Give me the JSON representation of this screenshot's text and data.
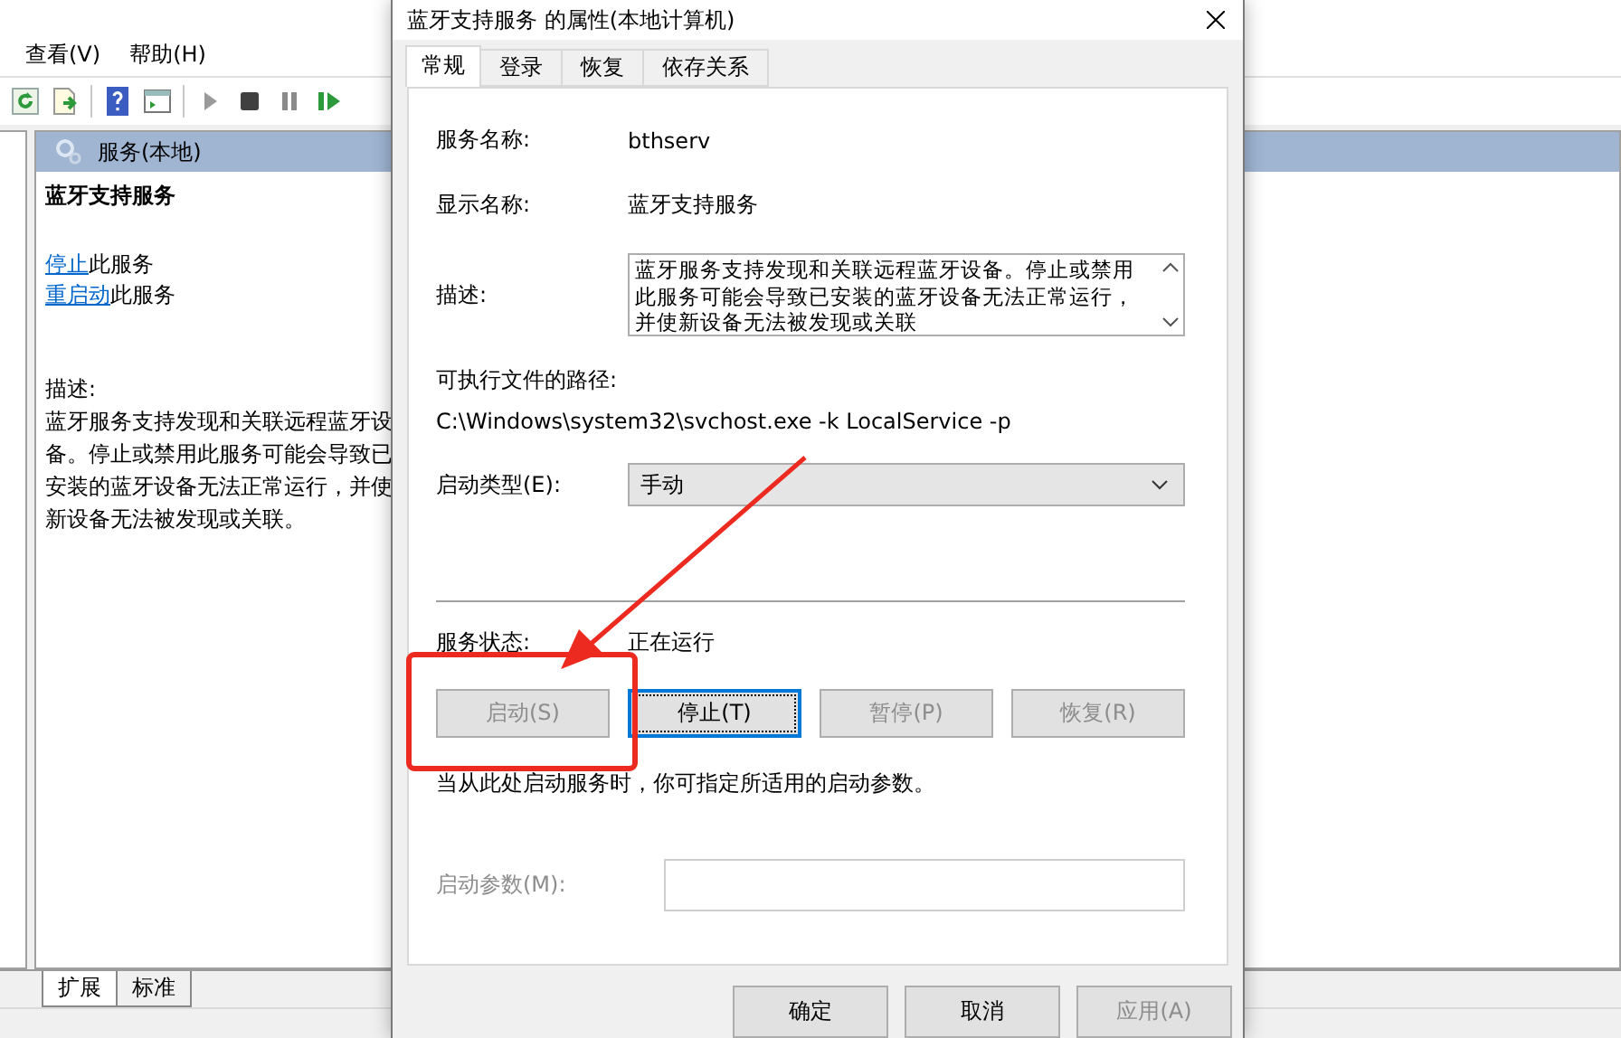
{
  "menu": [
    {
      "label": "查看(V)"
    },
    {
      "label": "帮助(H)"
    }
  ],
  "pane": {
    "header": "服务(本地)",
    "service_title": "蓝牙支持服务",
    "actions": [
      {
        "link": "停止",
        "text": "此服务"
      },
      {
        "link": "重启动",
        "text": "此服务"
      }
    ],
    "description_label": "描述:",
    "description": "蓝牙服务支持发现和关联远程蓝牙设备。停止或禁用此服务可能会导致已安装的蓝牙设备无法正常运行，并使新设备无法被发现或关联。"
  },
  "view_tabs": [
    {
      "label": "扩展",
      "selected": true
    },
    {
      "label": "标准",
      "selected": false
    }
  ],
  "dialog": {
    "title": "蓝牙支持服务 的属性(本地计算机)",
    "tabs": [
      {
        "label": "常规",
        "selected": true
      },
      {
        "label": "登录",
        "selected": false
      },
      {
        "label": "恢复",
        "selected": false
      },
      {
        "label": "依存关系",
        "selected": false
      }
    ],
    "service_name_label": "服务名称:",
    "service_name": "bthserv",
    "display_name_label": "显示名称:",
    "display_name": "蓝牙支持服务",
    "description_label": "描述:",
    "description": "蓝牙服务支持发现和关联远程蓝牙设备。停止或禁用此服务可能会导致已安装的蓝牙设备无法正常运行，并使新设备无法被发现或关联",
    "path_label": "可执行文件的路径:",
    "path": "C:\\Windows\\system32\\svchost.exe -k LocalService -p",
    "startup_type_label": "启动类型(E):",
    "startup_type": "手动",
    "status_label": "服务状态:",
    "status": "正在运行",
    "control_buttons": [
      {
        "label": "启动(S)",
        "disabled": true,
        "focused": false
      },
      {
        "label": "停止(T)",
        "disabled": false,
        "focused": true
      },
      {
        "label": "暂停(P)",
        "disabled": true,
        "focused": false
      },
      {
        "label": "恢复(R)",
        "disabled": true,
        "focused": false
      }
    ],
    "hint": "当从此处启动服务时，你可指定所适用的启动参数。",
    "params_label": "启动参数(M):",
    "params_disabled": true,
    "footer_buttons": [
      {
        "label": "确定",
        "disabled": false
      },
      {
        "label": "取消",
        "disabled": false
      },
      {
        "label": "应用(A)",
        "disabled": true
      }
    ]
  }
}
